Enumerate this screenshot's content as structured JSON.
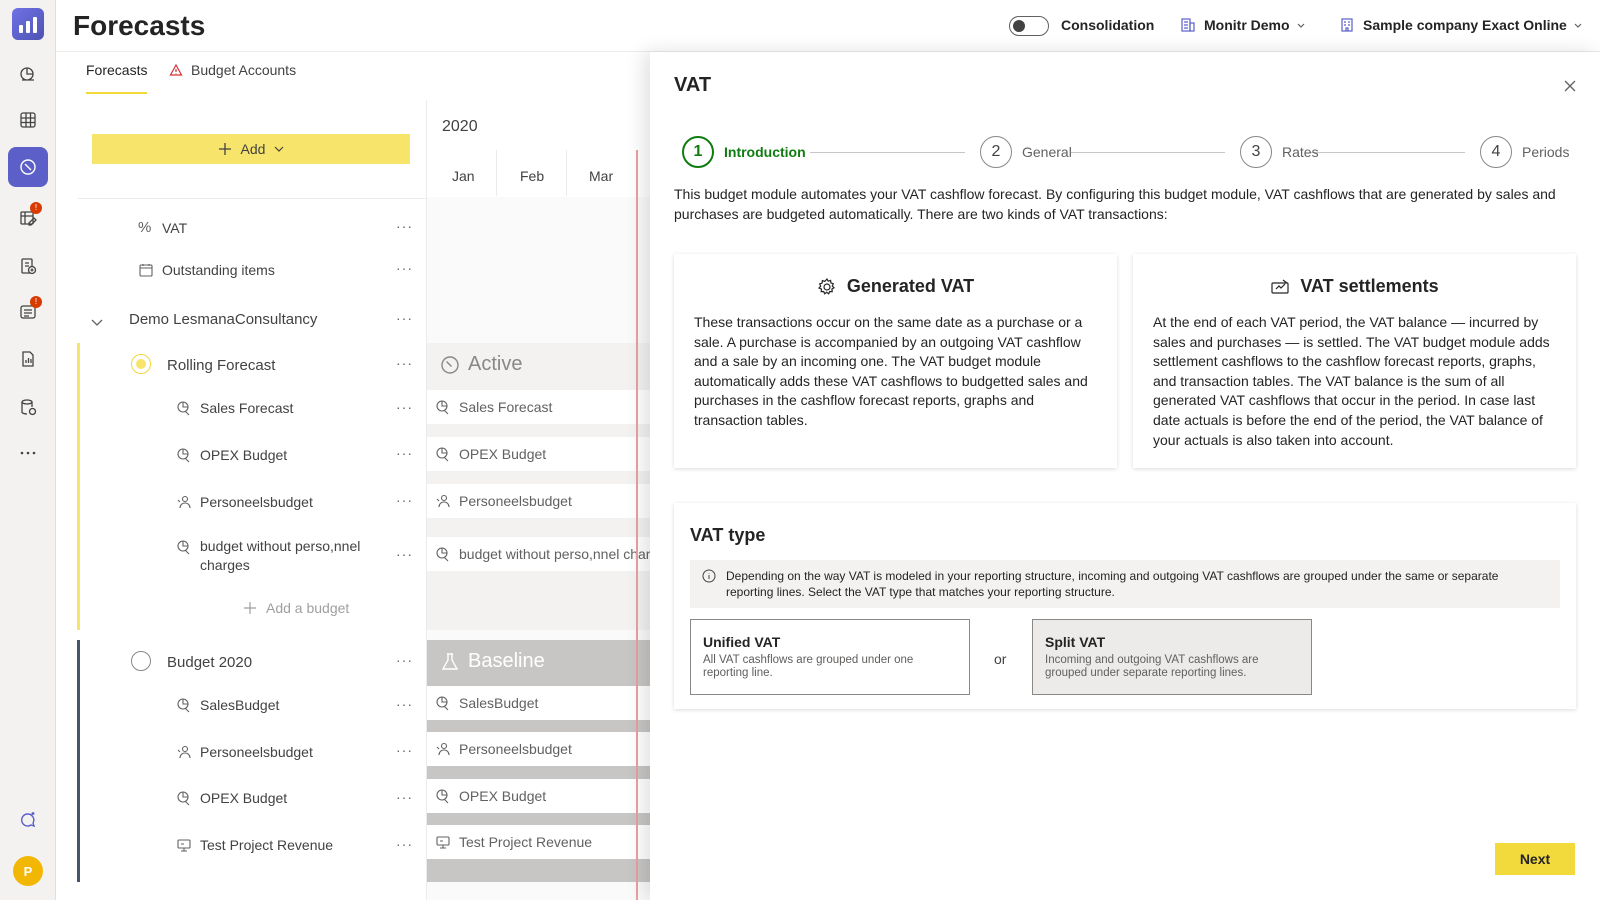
{
  "app": {
    "page_title": "Forecasts",
    "avatar_initial": "P",
    "accent_color": "#5b5fc7",
    "primary_color": "#f7e46a"
  },
  "header": {
    "consolidation_label": "Consolidation",
    "tenant": "Monitr Demo",
    "company": "Sample company Exact Online"
  },
  "tabs": [
    {
      "label": "Forecasts"
    },
    {
      "label": "Budget Accounts"
    }
  ],
  "add_button": {
    "label": "Add"
  },
  "tree": {
    "top_items": [
      {
        "label": "VAT",
        "icon": "percent-icon"
      },
      {
        "label": "Outstanding items",
        "icon": "calendar-icon"
      }
    ],
    "group": "Demo LesmanaConsultancy",
    "forecasts": [
      {
        "label": "Rolling Forecast",
        "status": "Active",
        "budgets": [
          {
            "label": "Sales Forecast",
            "icon": "chart-budget-icon"
          },
          {
            "label": "OPEX Budget",
            "icon": "chart-budget-icon"
          },
          {
            "label": "Personeelsbudget",
            "icon": "people-icon"
          },
          {
            "label": "budget without perso,nnel charges",
            "icon": "chart-budget-icon"
          }
        ],
        "add_budget_label": "Add a budget"
      },
      {
        "label": "Budget 2020",
        "status": "Baseline",
        "budgets": [
          {
            "label": "SalesBudget",
            "icon": "chart-budget-icon"
          },
          {
            "label": "Personeelsbudget",
            "icon": "people-icon"
          },
          {
            "label": "OPEX Budget",
            "icon": "chart-budget-icon"
          },
          {
            "label": "Test Project Revenue",
            "icon": "project-icon"
          }
        ]
      }
    ]
  },
  "timeline": {
    "year": "2020",
    "months": [
      "Jan",
      "Feb",
      "Mar"
    ],
    "rolling_bars": [
      "Sales Forecast",
      "OPEX Budget",
      "Personeelsbudget",
      "budget without perso,nnel charges"
    ],
    "baseline_bars": [
      "SalesBudget",
      "Personeelsbudget",
      "OPEX Budget",
      "Test Project Revenue"
    ]
  },
  "panel": {
    "title": "VAT",
    "steps": [
      {
        "num": "1",
        "label": "Introduction",
        "active": true
      },
      {
        "num": "2",
        "label": "General"
      },
      {
        "num": "3",
        "label": "Rates"
      },
      {
        "num": "4",
        "label": "Periods"
      }
    ],
    "intro": "This budget module automates your VAT cashflow forecast. By configuring this budget module, VAT cashflows that are generated by sales and purchases are budgeted automatically. There are two kinds of VAT transactions:",
    "cards": [
      {
        "title": "Generated VAT",
        "icon": "gear-icon",
        "body": "These transactions occur on the same date as a purchase or a sale. A purchase is accompanied by an outgoing VAT cashflow and a sale by an incoming one. The VAT budget module automatically adds these VAT cashflows to budgetted sales and purchases in the cashflow forecast reports, graphs and transaction tables."
      },
      {
        "title": "VAT settlements",
        "icon": "settlement-icon",
        "body": "At the end of each VAT period, the VAT balance — incurred by sales and purchases — is settled. The VAT budget module adds settlement cashflows to the cashflow forecast reports, graphs, and transaction tables. The VAT balance is the sum of all generated VAT cashflows that occur in the period. In case last date actuals is before the end of the period, the VAT balance of your actuals is also taken into account."
      }
    ],
    "vat_type": {
      "title": "VAT type",
      "info": "Depending on the way VAT is modeled in your reporting structure, incoming and outgoing VAT cashflows are grouped under the same or separate reporting lines. Select the VAT type that matches your reporting structure.",
      "or_label": "or",
      "options": [
        {
          "title": "Unified VAT",
          "desc": "All VAT cashflows are grouped under one reporting line.",
          "selected": false
        },
        {
          "title": "Split VAT",
          "desc": "Incoming and outgoing VAT cashflows are grouped under separate reporting lines.",
          "selected": true
        }
      ]
    },
    "next_label": "Next"
  }
}
